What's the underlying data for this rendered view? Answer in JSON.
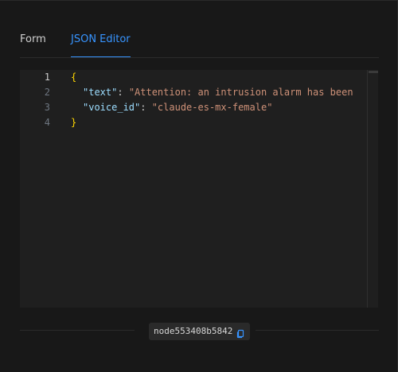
{
  "tabs": {
    "form_label": "Form",
    "json_label": "JSON Editor",
    "active": "JSON Editor"
  },
  "editor": {
    "line_numbers": [
      "1",
      "2",
      "3",
      "4"
    ],
    "active_line": "1",
    "lines": {
      "l1_open": "{",
      "l2_key": "\"text\"",
      "l2_colon": ": ",
      "l2_value": "\"Attention: an intrusion alarm has been",
      "l3_key": "\"voice_id\"",
      "l3_colon": ": ",
      "l3_value": "\"claude-es-mx-female\"",
      "l4_close": "}"
    }
  },
  "footer": {
    "node_id": "node553408b5842",
    "copy_icon": "copy-icon"
  },
  "colors": {
    "accent": "#3794ff",
    "brace": "#ffd700",
    "key": "#9cdcfe",
    "string": "#ce9178"
  }
}
